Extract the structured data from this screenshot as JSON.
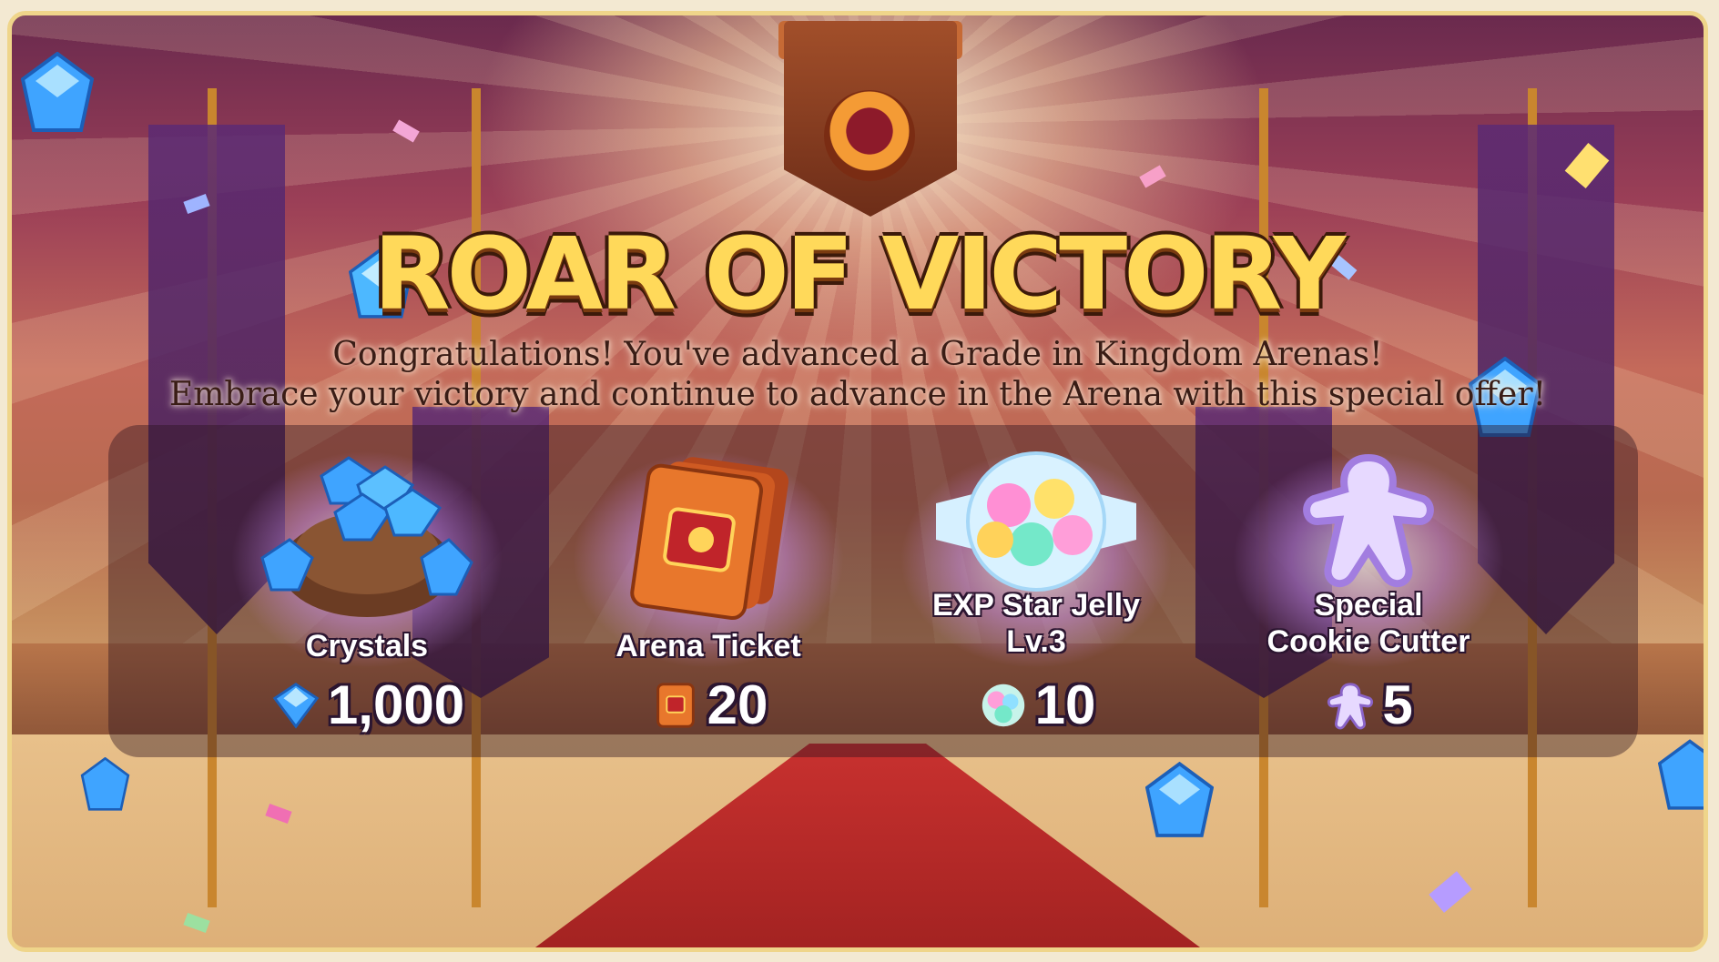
{
  "dialog": {
    "title": "ROAR OF VICTORY",
    "message_line1": "Congratulations! You've advanced a Grade in Kingdom Arenas!",
    "message_line2": "Embrace your victory and continue to advance in the Arena with this special offer!"
  },
  "rewards": [
    {
      "name": "Crystals",
      "amount": "1,000",
      "icon": "crystal-pouch-icon",
      "small_icon": "crystal-icon"
    },
    {
      "name": "Arena Ticket",
      "amount": "20",
      "icon": "arena-ticket-icon",
      "small_icon": "arena-ticket-small-icon"
    },
    {
      "name": "EXP Star Jelly Lv.3",
      "name_line1": "EXP Star Jelly",
      "name_line2": "Lv.3",
      "amount": "10",
      "icon": "exp-star-jelly-icon",
      "small_icon": "star-jelly-small-icon"
    },
    {
      "name": "Special Cookie Cutter",
      "name_line1": "Special",
      "name_line2": "Cookie Cutter",
      "amount": "5",
      "icon": "cookie-cutter-icon",
      "small_icon": "cookie-cutter-small-icon"
    }
  ],
  "colors": {
    "title_gold": "#ffd95a",
    "title_outline": "#3c1a0a",
    "panel": "#2d141e",
    "carpet": "#c8312f",
    "banner": "#5b2a74"
  }
}
